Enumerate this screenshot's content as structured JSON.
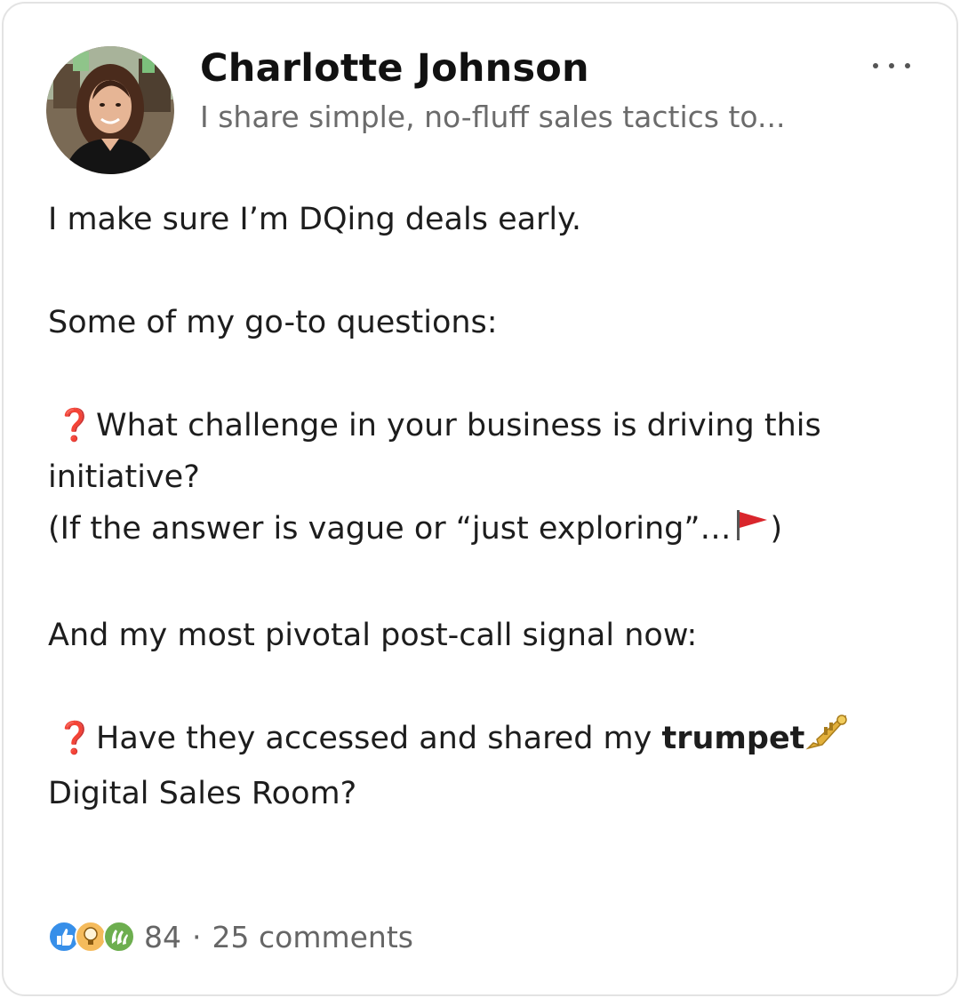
{
  "post": {
    "author": {
      "name": "Charlotte Johnson",
      "headline": "I share simple, no-fluff sales tactics to..."
    },
    "more_options_icon": "ellipsis-horizontal-icon",
    "body": {
      "line1": "I make sure I’m DQing deals early.",
      "line2": "Some of my go-to questions:",
      "q1_marker": "❓",
      "q1_text_a": "What challenge in your business is driving this",
      "q1_text_b": "initiative?",
      "q1_note": " (If the answer is vague or “just exploring”…",
      "q1_note_emoji": "red-flag-icon",
      "q1_note_close": ")",
      "line3": "And my most pivotal post-call signal now:",
      "q2_marker": "❓",
      "q2_text_a": "Have they accessed and shared my",
      "q2_bold": "trumpet",
      "q2_emoji": "trumpet-icon",
      "q2_text_b": "Digital Sales Room?"
    },
    "reactions": {
      "icons": [
        "like-icon",
        "insightful-icon",
        "celebrate-icon"
      ],
      "count": "84",
      "separator": "·",
      "comments": "25 comments"
    },
    "colors": {
      "question_mark": "#d7101e",
      "secondary_text": "#6b6b6b",
      "border": "#e3e3e3"
    }
  }
}
